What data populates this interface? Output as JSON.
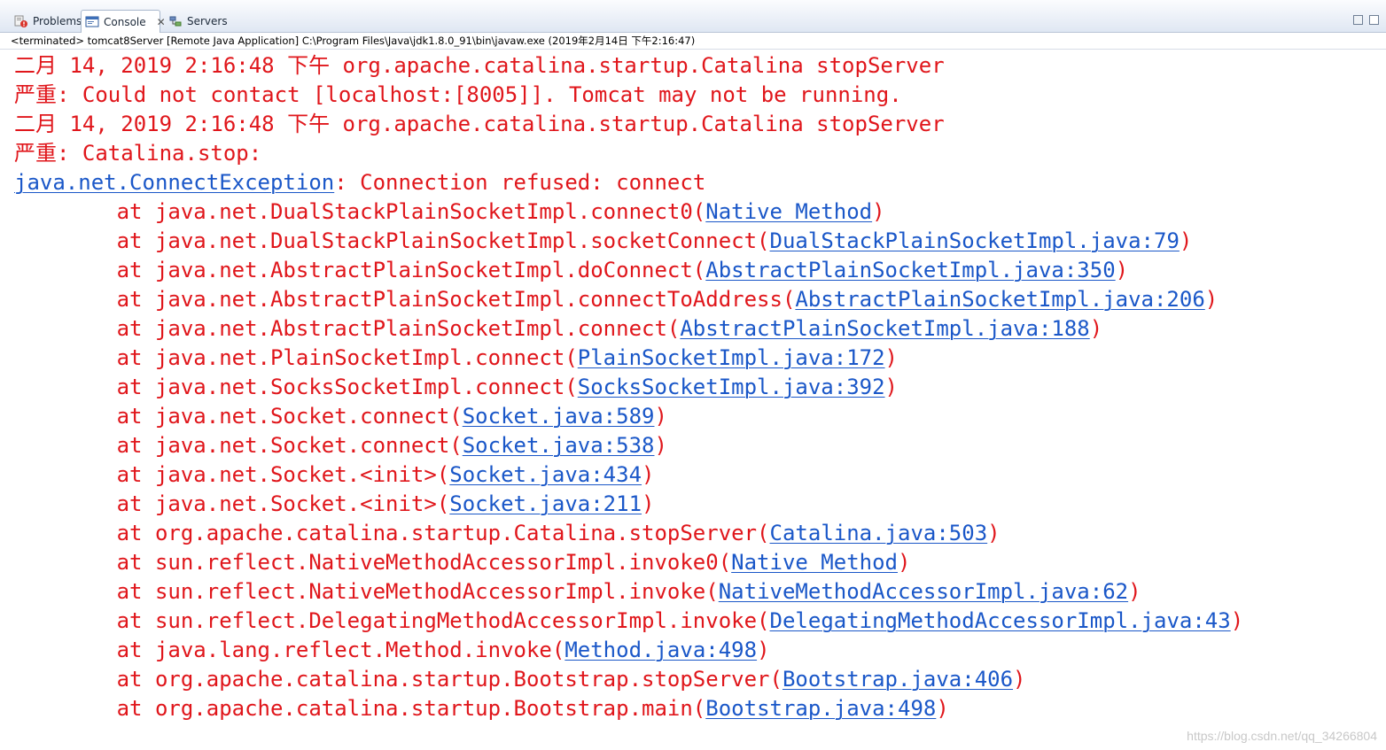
{
  "tabs": [
    {
      "label": "Problems",
      "icon": "problems-icon",
      "active": false
    },
    {
      "label": "Console",
      "icon": "console-icon",
      "active": true,
      "close": "✕"
    },
    {
      "label": "Servers",
      "icon": "servers-icon",
      "active": false
    }
  ],
  "status": "<terminated> tomcat8Server [Remote Java Application] C:\\Program Files\\Java\\jdk1.8.0_91\\bin\\javaw.exe (2019年2月14日 下午2:16:47)",
  "console": {
    "header_lines": [
      "二月 14, 2019 2:16:48 下午 org.apache.catalina.startup.Catalina stopServer",
      "严重: Could not contact [localhost:[8005]]. Tomcat may not be running.",
      "二月 14, 2019 2:16:48 下午 org.apache.catalina.startup.Catalina stopServer",
      "严重: Catalina.stop:"
    ],
    "exception": {
      "link": "java.net.ConnectException",
      "message": ": Connection refused: connect"
    },
    "frames": [
      {
        "prefix": "\tat java.net.DualStackPlainSocketImpl.connect0(",
        "link": "Native Method",
        "suffix": ")"
      },
      {
        "prefix": "\tat java.net.DualStackPlainSocketImpl.socketConnect(",
        "link": "DualStackPlainSocketImpl.java:79",
        "suffix": ")"
      },
      {
        "prefix": "\tat java.net.AbstractPlainSocketImpl.doConnect(",
        "link": "AbstractPlainSocketImpl.java:350",
        "suffix": ")"
      },
      {
        "prefix": "\tat java.net.AbstractPlainSocketImpl.connectToAddress(",
        "link": "AbstractPlainSocketImpl.java:206",
        "suffix": ")"
      },
      {
        "prefix": "\tat java.net.AbstractPlainSocketImpl.connect(",
        "link": "AbstractPlainSocketImpl.java:188",
        "suffix": ")"
      },
      {
        "prefix": "\tat java.net.PlainSocketImpl.connect(",
        "link": "PlainSocketImpl.java:172",
        "suffix": ")"
      },
      {
        "prefix": "\tat java.net.SocksSocketImpl.connect(",
        "link": "SocksSocketImpl.java:392",
        "suffix": ")"
      },
      {
        "prefix": "\tat java.net.Socket.connect(",
        "link": "Socket.java:589",
        "suffix": ")"
      },
      {
        "prefix": "\tat java.net.Socket.connect(",
        "link": "Socket.java:538",
        "suffix": ")"
      },
      {
        "prefix": "\tat java.net.Socket.<init>(",
        "link": "Socket.java:434",
        "suffix": ")"
      },
      {
        "prefix": "\tat java.net.Socket.<init>(",
        "link": "Socket.java:211",
        "suffix": ")"
      },
      {
        "prefix": "\tat org.apache.catalina.startup.Catalina.stopServer(",
        "link": "Catalina.java:503",
        "suffix": ")"
      },
      {
        "prefix": "\tat sun.reflect.NativeMethodAccessorImpl.invoke0(",
        "link": "Native Method",
        "suffix": ")"
      },
      {
        "prefix": "\tat sun.reflect.NativeMethodAccessorImpl.invoke(",
        "link": "NativeMethodAccessorImpl.java:62",
        "suffix": ")"
      },
      {
        "prefix": "\tat sun.reflect.DelegatingMethodAccessorImpl.invoke(",
        "link": "DelegatingMethodAccessorImpl.java:43",
        "suffix": ")"
      },
      {
        "prefix": "\tat java.lang.reflect.Method.invoke(",
        "link": "Method.java:498",
        "suffix": ")"
      },
      {
        "prefix": "\tat org.apache.catalina.startup.Bootstrap.stopServer(",
        "link": "Bootstrap.java:406",
        "suffix": ")"
      },
      {
        "prefix": "\tat org.apache.catalina.startup.Bootstrap.main(",
        "link": "Bootstrap.java:498",
        "suffix": ")"
      }
    ]
  },
  "watermark": "https://blog.csdn.net/qq_34266804",
  "colors": {
    "error_text": "#e0161b",
    "link_text": "#1a57c8"
  }
}
